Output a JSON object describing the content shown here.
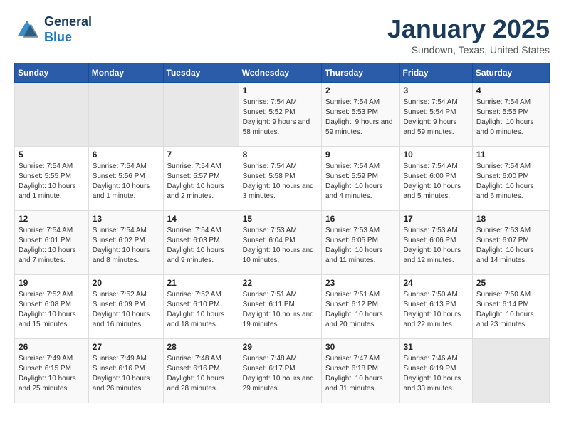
{
  "logo": {
    "line1": "General",
    "line2": "Blue"
  },
  "title": "January 2025",
  "subtitle": "Sundown, Texas, United States",
  "headers": [
    "Sunday",
    "Monday",
    "Tuesday",
    "Wednesday",
    "Thursday",
    "Friday",
    "Saturday"
  ],
  "weeks": [
    [
      {
        "day": "",
        "sunrise": "",
        "sunset": "",
        "daylight": "",
        "empty": true
      },
      {
        "day": "",
        "sunrise": "",
        "sunset": "",
        "daylight": "",
        "empty": true
      },
      {
        "day": "",
        "sunrise": "",
        "sunset": "",
        "daylight": "",
        "empty": true
      },
      {
        "day": "1",
        "sunrise": "Sunrise: 7:54 AM",
        "sunset": "Sunset: 5:52 PM",
        "daylight": "Daylight: 9 hours and 58 minutes."
      },
      {
        "day": "2",
        "sunrise": "Sunrise: 7:54 AM",
        "sunset": "Sunset: 5:53 PM",
        "daylight": "Daylight: 9 hours and 59 minutes."
      },
      {
        "day": "3",
        "sunrise": "Sunrise: 7:54 AM",
        "sunset": "Sunset: 5:54 PM",
        "daylight": "Daylight: 9 hours and 59 minutes."
      },
      {
        "day": "4",
        "sunrise": "Sunrise: 7:54 AM",
        "sunset": "Sunset: 5:55 PM",
        "daylight": "Daylight: 10 hours and 0 minutes."
      }
    ],
    [
      {
        "day": "5",
        "sunrise": "Sunrise: 7:54 AM",
        "sunset": "Sunset: 5:55 PM",
        "daylight": "Daylight: 10 hours and 1 minute."
      },
      {
        "day": "6",
        "sunrise": "Sunrise: 7:54 AM",
        "sunset": "Sunset: 5:56 PM",
        "daylight": "Daylight: 10 hours and 1 minute."
      },
      {
        "day": "7",
        "sunrise": "Sunrise: 7:54 AM",
        "sunset": "Sunset: 5:57 PM",
        "daylight": "Daylight: 10 hours and 2 minutes."
      },
      {
        "day": "8",
        "sunrise": "Sunrise: 7:54 AM",
        "sunset": "Sunset: 5:58 PM",
        "daylight": "Daylight: 10 hours and 3 minutes."
      },
      {
        "day": "9",
        "sunrise": "Sunrise: 7:54 AM",
        "sunset": "Sunset: 5:59 PM",
        "daylight": "Daylight: 10 hours and 4 minutes."
      },
      {
        "day": "10",
        "sunrise": "Sunrise: 7:54 AM",
        "sunset": "Sunset: 6:00 PM",
        "daylight": "Daylight: 10 hours and 5 minutes."
      },
      {
        "day": "11",
        "sunrise": "Sunrise: 7:54 AM",
        "sunset": "Sunset: 6:00 PM",
        "daylight": "Daylight: 10 hours and 6 minutes."
      }
    ],
    [
      {
        "day": "12",
        "sunrise": "Sunrise: 7:54 AM",
        "sunset": "Sunset: 6:01 PM",
        "daylight": "Daylight: 10 hours and 7 minutes."
      },
      {
        "day": "13",
        "sunrise": "Sunrise: 7:54 AM",
        "sunset": "Sunset: 6:02 PM",
        "daylight": "Daylight: 10 hours and 8 minutes."
      },
      {
        "day": "14",
        "sunrise": "Sunrise: 7:54 AM",
        "sunset": "Sunset: 6:03 PM",
        "daylight": "Daylight: 10 hours and 9 minutes."
      },
      {
        "day": "15",
        "sunrise": "Sunrise: 7:53 AM",
        "sunset": "Sunset: 6:04 PM",
        "daylight": "Daylight: 10 hours and 10 minutes."
      },
      {
        "day": "16",
        "sunrise": "Sunrise: 7:53 AM",
        "sunset": "Sunset: 6:05 PM",
        "daylight": "Daylight: 10 hours and 11 minutes."
      },
      {
        "day": "17",
        "sunrise": "Sunrise: 7:53 AM",
        "sunset": "Sunset: 6:06 PM",
        "daylight": "Daylight: 10 hours and 12 minutes."
      },
      {
        "day": "18",
        "sunrise": "Sunrise: 7:53 AM",
        "sunset": "Sunset: 6:07 PM",
        "daylight": "Daylight: 10 hours and 14 minutes."
      }
    ],
    [
      {
        "day": "19",
        "sunrise": "Sunrise: 7:52 AM",
        "sunset": "Sunset: 6:08 PM",
        "daylight": "Daylight: 10 hours and 15 minutes."
      },
      {
        "day": "20",
        "sunrise": "Sunrise: 7:52 AM",
        "sunset": "Sunset: 6:09 PM",
        "daylight": "Daylight: 10 hours and 16 minutes."
      },
      {
        "day": "21",
        "sunrise": "Sunrise: 7:52 AM",
        "sunset": "Sunset: 6:10 PM",
        "daylight": "Daylight: 10 hours and 18 minutes."
      },
      {
        "day": "22",
        "sunrise": "Sunrise: 7:51 AM",
        "sunset": "Sunset: 6:11 PM",
        "daylight": "Daylight: 10 hours and 19 minutes."
      },
      {
        "day": "23",
        "sunrise": "Sunrise: 7:51 AM",
        "sunset": "Sunset: 6:12 PM",
        "daylight": "Daylight: 10 hours and 20 minutes."
      },
      {
        "day": "24",
        "sunrise": "Sunrise: 7:50 AM",
        "sunset": "Sunset: 6:13 PM",
        "daylight": "Daylight: 10 hours and 22 minutes."
      },
      {
        "day": "25",
        "sunrise": "Sunrise: 7:50 AM",
        "sunset": "Sunset: 6:14 PM",
        "daylight": "Daylight: 10 hours and 23 minutes."
      }
    ],
    [
      {
        "day": "26",
        "sunrise": "Sunrise: 7:49 AM",
        "sunset": "Sunset: 6:15 PM",
        "daylight": "Daylight: 10 hours and 25 minutes."
      },
      {
        "day": "27",
        "sunrise": "Sunrise: 7:49 AM",
        "sunset": "Sunset: 6:16 PM",
        "daylight": "Daylight: 10 hours and 26 minutes."
      },
      {
        "day": "28",
        "sunrise": "Sunrise: 7:48 AM",
        "sunset": "Sunset: 6:16 PM",
        "daylight": "Daylight: 10 hours and 28 minutes."
      },
      {
        "day": "29",
        "sunrise": "Sunrise: 7:48 AM",
        "sunset": "Sunset: 6:17 PM",
        "daylight": "Daylight: 10 hours and 29 minutes."
      },
      {
        "day": "30",
        "sunrise": "Sunrise: 7:47 AM",
        "sunset": "Sunset: 6:18 PM",
        "daylight": "Daylight: 10 hours and 31 minutes."
      },
      {
        "day": "31",
        "sunrise": "Sunrise: 7:46 AM",
        "sunset": "Sunset: 6:19 PM",
        "daylight": "Daylight: 10 hours and 33 minutes."
      },
      {
        "day": "",
        "sunrise": "",
        "sunset": "",
        "daylight": "",
        "empty": true
      }
    ]
  ]
}
